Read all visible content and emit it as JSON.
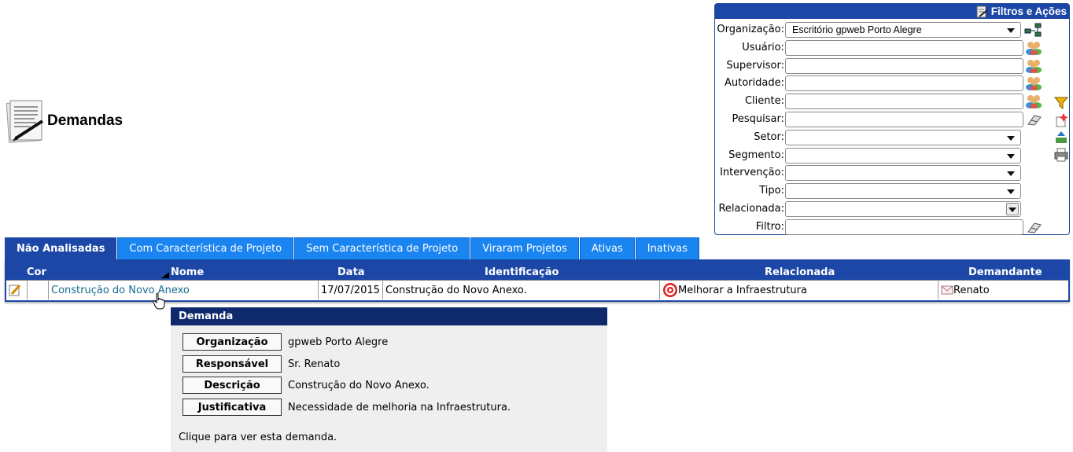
{
  "page": {
    "title": "Demandas"
  },
  "filters": {
    "header": "Filtros e Ações",
    "organizacao": {
      "label": "Organização:",
      "value": "Escritório gpweb Porto Alegre"
    },
    "usuario": {
      "label": "Usuário:",
      "value": ""
    },
    "supervisor": {
      "label": "Supervisor:",
      "value": ""
    },
    "autoridade": {
      "label": "Autoridade:",
      "value": ""
    },
    "cliente": {
      "label": "Cliente:",
      "value": ""
    },
    "pesquisar": {
      "label": "Pesquisar:",
      "value": ""
    },
    "setor": {
      "label": "Setor:",
      "value": ""
    },
    "segmento": {
      "label": "Segmento:",
      "value": ""
    },
    "intervencao": {
      "label": "Intervenção:",
      "value": ""
    },
    "tipo": {
      "label": "Tipo:",
      "value": ""
    },
    "relacionada": {
      "label": "Relacionada:",
      "value": ""
    },
    "filtro": {
      "label": "Filtro:",
      "value": ""
    }
  },
  "tabs": [
    {
      "label": "Não Analisadas",
      "active": true
    },
    {
      "label": "Com Característica de Projeto",
      "active": false
    },
    {
      "label": "Sem Característica de Projeto",
      "active": false
    },
    {
      "label": "Viraram Projetos",
      "active": false
    },
    {
      "label": "Ativas",
      "active": false
    },
    {
      "label": "Inativas",
      "active": false
    }
  ],
  "table": {
    "headers": {
      "cor": "Cor",
      "nome": "Nome",
      "data": "Data",
      "identificacao": "Identificação",
      "relacionada": "Relacionada",
      "demandante": "Demandante"
    },
    "rows": [
      {
        "nome": "Construção do Novo Anexo",
        "data": "17/07/2015",
        "identificacao": "Construção do Novo Anexo.",
        "relacionada": "Melhorar a Infraestrutura",
        "demandante": "Renato"
      }
    ]
  },
  "tooltip": {
    "title": "Demanda",
    "fields": [
      {
        "label": "Organização",
        "value": "gpweb Porto Alegre"
      },
      {
        "label": "Responsável",
        "value": "Sr. Renato"
      },
      {
        "label": "Descrição",
        "value": "Construção do Novo Anexo."
      },
      {
        "label": "Justificativa",
        "value": "Necessidade de melhoria na Infraestrutura."
      }
    ],
    "footer": "Clique para ver esta demanda."
  },
  "colors": {
    "header_blue": "#1c47a6",
    "tab_blue": "#1a84f0",
    "link": "#156a8f",
    "tooltip_head": "#0e2a6c"
  }
}
